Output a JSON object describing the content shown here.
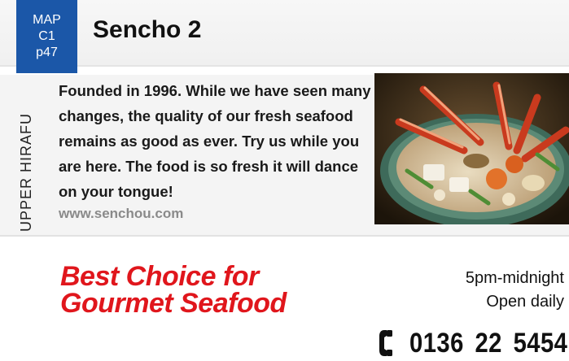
{
  "map_badge": {
    "line1": "MAP",
    "line2": "C1",
    "line3": "p47"
  },
  "title": "Sencho 2",
  "area_label": "UPPER HIRAFU",
  "description": "Founded in 1996. While we have seen many changes, the quality of our fresh seafood remains as good as ever. Try us while you are here. The food is so fresh it will dance on your tongue!",
  "website": "www.senchou.com",
  "photo": {
    "subject": "seafood hot pot with crab legs"
  },
  "tagline": {
    "line1": "Best Choice for",
    "line2": "Gourmet Seafood"
  },
  "hours": {
    "time": "5pm-midnight",
    "days": "Open daily"
  },
  "phone": {
    "icon": "phone-icon",
    "number": "0136 22 5454"
  },
  "colors": {
    "badge_blue": "#1b57a8",
    "tagline_red": "#e0161c",
    "website_gray": "#8a8a8a"
  }
}
